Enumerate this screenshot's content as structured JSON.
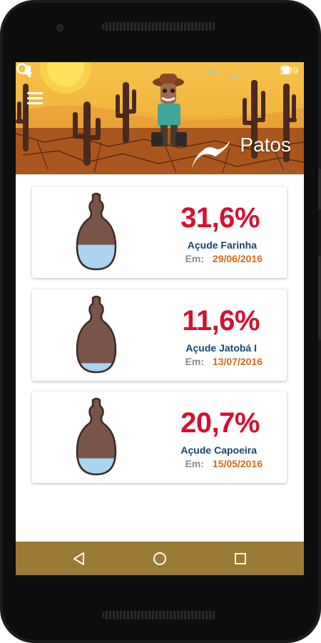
{
  "statusbar": {
    "time": "9:49"
  },
  "header": {
    "city": "Patos"
  },
  "reservoirs": [
    {
      "percent": "31,6%",
      "fill": 0.316,
      "name": "Açude Farinha",
      "date_label": "Em:",
      "date": "29/06/2016"
    },
    {
      "percent": "11,6%",
      "fill": 0.116,
      "name": "Açude Jatobá I",
      "date_label": "Em:",
      "date": "13/07/2016"
    },
    {
      "percent": "20,7%",
      "fill": 0.207,
      "name": "Açude Capoeira",
      "date_label": "Em:",
      "date": "15/05/2016"
    }
  ],
  "colors": {
    "percent": "#d5102e",
    "name": "#17456b",
    "date": "#d4691b",
    "water": "#a9d4f2",
    "jar": "#7a5448",
    "navbar": "#9a7a35"
  },
  "icons": {
    "menu": "menu-icon",
    "search": "search-icon",
    "back": "back-triangle-icon",
    "home": "home-circle-icon",
    "recents": "recents-square-icon"
  }
}
